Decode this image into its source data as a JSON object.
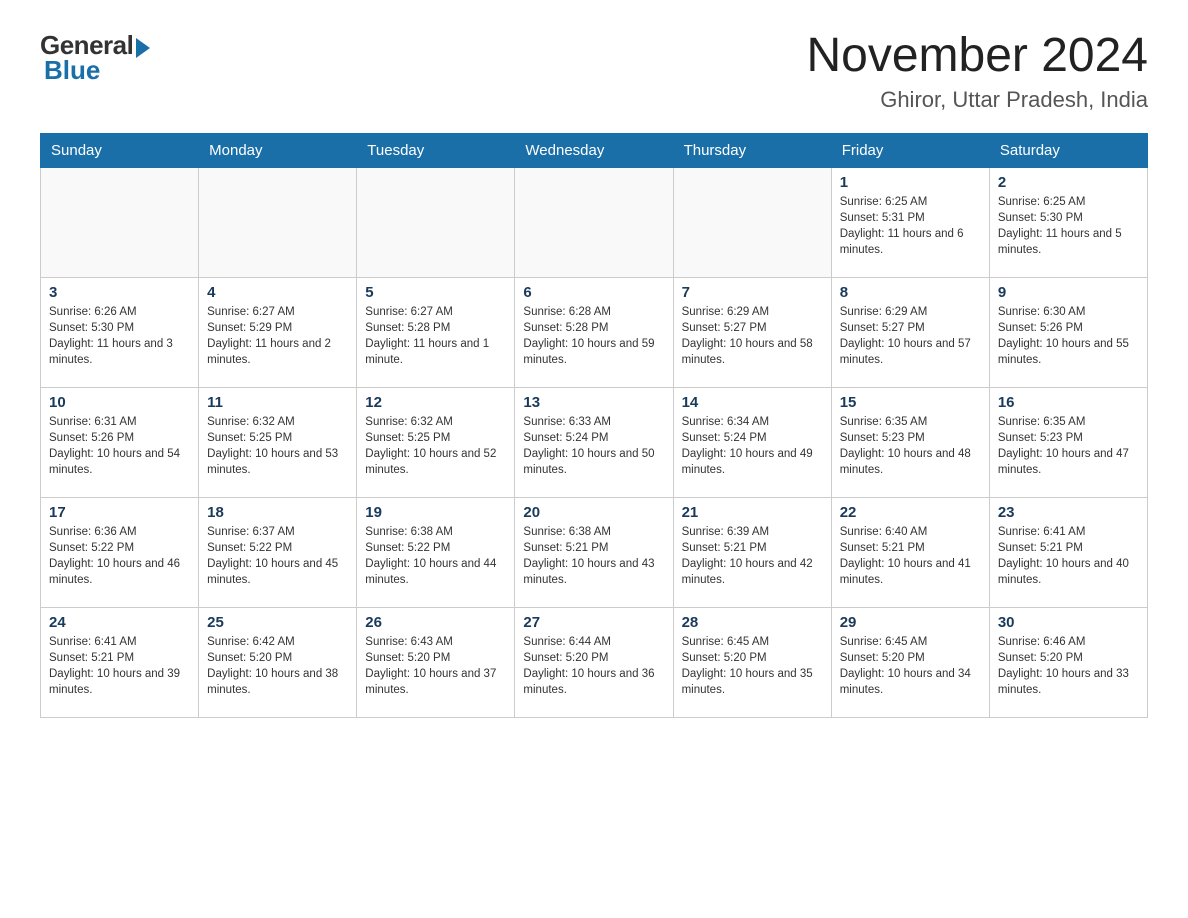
{
  "logo": {
    "general": "General",
    "blue": "Blue"
  },
  "title": "November 2024",
  "subtitle": "Ghiror, Uttar Pradesh, India",
  "weekdays": [
    "Sunday",
    "Monday",
    "Tuesday",
    "Wednesday",
    "Thursday",
    "Friday",
    "Saturday"
  ],
  "weeks": [
    [
      {
        "day": "",
        "info": ""
      },
      {
        "day": "",
        "info": ""
      },
      {
        "day": "",
        "info": ""
      },
      {
        "day": "",
        "info": ""
      },
      {
        "day": "",
        "info": ""
      },
      {
        "day": "1",
        "info": "Sunrise: 6:25 AM\nSunset: 5:31 PM\nDaylight: 11 hours and 6 minutes."
      },
      {
        "day": "2",
        "info": "Sunrise: 6:25 AM\nSunset: 5:30 PM\nDaylight: 11 hours and 5 minutes."
      }
    ],
    [
      {
        "day": "3",
        "info": "Sunrise: 6:26 AM\nSunset: 5:30 PM\nDaylight: 11 hours and 3 minutes."
      },
      {
        "day": "4",
        "info": "Sunrise: 6:27 AM\nSunset: 5:29 PM\nDaylight: 11 hours and 2 minutes."
      },
      {
        "day": "5",
        "info": "Sunrise: 6:27 AM\nSunset: 5:28 PM\nDaylight: 11 hours and 1 minute."
      },
      {
        "day": "6",
        "info": "Sunrise: 6:28 AM\nSunset: 5:28 PM\nDaylight: 10 hours and 59 minutes."
      },
      {
        "day": "7",
        "info": "Sunrise: 6:29 AM\nSunset: 5:27 PM\nDaylight: 10 hours and 58 minutes."
      },
      {
        "day": "8",
        "info": "Sunrise: 6:29 AM\nSunset: 5:27 PM\nDaylight: 10 hours and 57 minutes."
      },
      {
        "day": "9",
        "info": "Sunrise: 6:30 AM\nSunset: 5:26 PM\nDaylight: 10 hours and 55 minutes."
      }
    ],
    [
      {
        "day": "10",
        "info": "Sunrise: 6:31 AM\nSunset: 5:26 PM\nDaylight: 10 hours and 54 minutes."
      },
      {
        "day": "11",
        "info": "Sunrise: 6:32 AM\nSunset: 5:25 PM\nDaylight: 10 hours and 53 minutes."
      },
      {
        "day": "12",
        "info": "Sunrise: 6:32 AM\nSunset: 5:25 PM\nDaylight: 10 hours and 52 minutes."
      },
      {
        "day": "13",
        "info": "Sunrise: 6:33 AM\nSunset: 5:24 PM\nDaylight: 10 hours and 50 minutes."
      },
      {
        "day": "14",
        "info": "Sunrise: 6:34 AM\nSunset: 5:24 PM\nDaylight: 10 hours and 49 minutes."
      },
      {
        "day": "15",
        "info": "Sunrise: 6:35 AM\nSunset: 5:23 PM\nDaylight: 10 hours and 48 minutes."
      },
      {
        "day": "16",
        "info": "Sunrise: 6:35 AM\nSunset: 5:23 PM\nDaylight: 10 hours and 47 minutes."
      }
    ],
    [
      {
        "day": "17",
        "info": "Sunrise: 6:36 AM\nSunset: 5:22 PM\nDaylight: 10 hours and 46 minutes."
      },
      {
        "day": "18",
        "info": "Sunrise: 6:37 AM\nSunset: 5:22 PM\nDaylight: 10 hours and 45 minutes."
      },
      {
        "day": "19",
        "info": "Sunrise: 6:38 AM\nSunset: 5:22 PM\nDaylight: 10 hours and 44 minutes."
      },
      {
        "day": "20",
        "info": "Sunrise: 6:38 AM\nSunset: 5:21 PM\nDaylight: 10 hours and 43 minutes."
      },
      {
        "day": "21",
        "info": "Sunrise: 6:39 AM\nSunset: 5:21 PM\nDaylight: 10 hours and 42 minutes."
      },
      {
        "day": "22",
        "info": "Sunrise: 6:40 AM\nSunset: 5:21 PM\nDaylight: 10 hours and 41 minutes."
      },
      {
        "day": "23",
        "info": "Sunrise: 6:41 AM\nSunset: 5:21 PM\nDaylight: 10 hours and 40 minutes."
      }
    ],
    [
      {
        "day": "24",
        "info": "Sunrise: 6:41 AM\nSunset: 5:21 PM\nDaylight: 10 hours and 39 minutes."
      },
      {
        "day": "25",
        "info": "Sunrise: 6:42 AM\nSunset: 5:20 PM\nDaylight: 10 hours and 38 minutes."
      },
      {
        "day": "26",
        "info": "Sunrise: 6:43 AM\nSunset: 5:20 PM\nDaylight: 10 hours and 37 minutes."
      },
      {
        "day": "27",
        "info": "Sunrise: 6:44 AM\nSunset: 5:20 PM\nDaylight: 10 hours and 36 minutes."
      },
      {
        "day": "28",
        "info": "Sunrise: 6:45 AM\nSunset: 5:20 PM\nDaylight: 10 hours and 35 minutes."
      },
      {
        "day": "29",
        "info": "Sunrise: 6:45 AM\nSunset: 5:20 PM\nDaylight: 10 hours and 34 minutes."
      },
      {
        "day": "30",
        "info": "Sunrise: 6:46 AM\nSunset: 5:20 PM\nDaylight: 10 hours and 33 minutes."
      }
    ]
  ]
}
